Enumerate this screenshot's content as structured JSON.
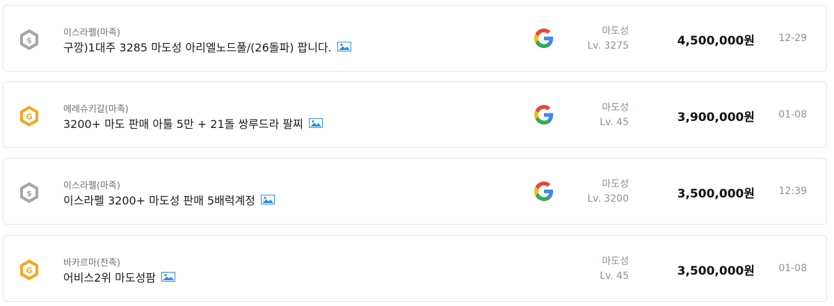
{
  "listings": [
    {
      "server": "이스라펠(마족)",
      "title": "구깡)1대주 3285 마도성 아리엘노드풀/(26돌파) 팝니다.",
      "badge_icon": "silver-seller-badge-icon",
      "badge_color": "#9a9a9a",
      "has_google": true,
      "class": "마도성",
      "level": "Lv. 3275",
      "price": "4,500,000원",
      "date": "12-29"
    },
    {
      "server": "에레슈키갈(마족)",
      "title": "3200+ 마도 판매 아툴 5만 + 21돌 쌍루드라 팔찌",
      "badge_icon": "gold-seller-badge-icon",
      "badge_color": "#f5a623",
      "has_google": true,
      "class": "마도성",
      "level": "Lv. 45",
      "price": "3,900,000원",
      "date": "01-08"
    },
    {
      "server": "이스라펠(마족)",
      "title": "이스라펠 3200+ 마도성 판매 5배럭계정",
      "badge_icon": "silver-seller-badge-icon",
      "badge_color": "#9a9a9a",
      "has_google": true,
      "class": "마도성",
      "level": "Lv. 3200",
      "price": "3,500,000원",
      "date": "12:39"
    },
    {
      "server": "바카르마(천족)",
      "title": "어비스2위 마도성팜",
      "badge_icon": "gold-seller-badge-icon",
      "badge_color": "#f5a623",
      "has_google": false,
      "class": "마도성",
      "level": "Lv. 45",
      "price": "3,500,000원",
      "date": "01-08"
    }
  ]
}
